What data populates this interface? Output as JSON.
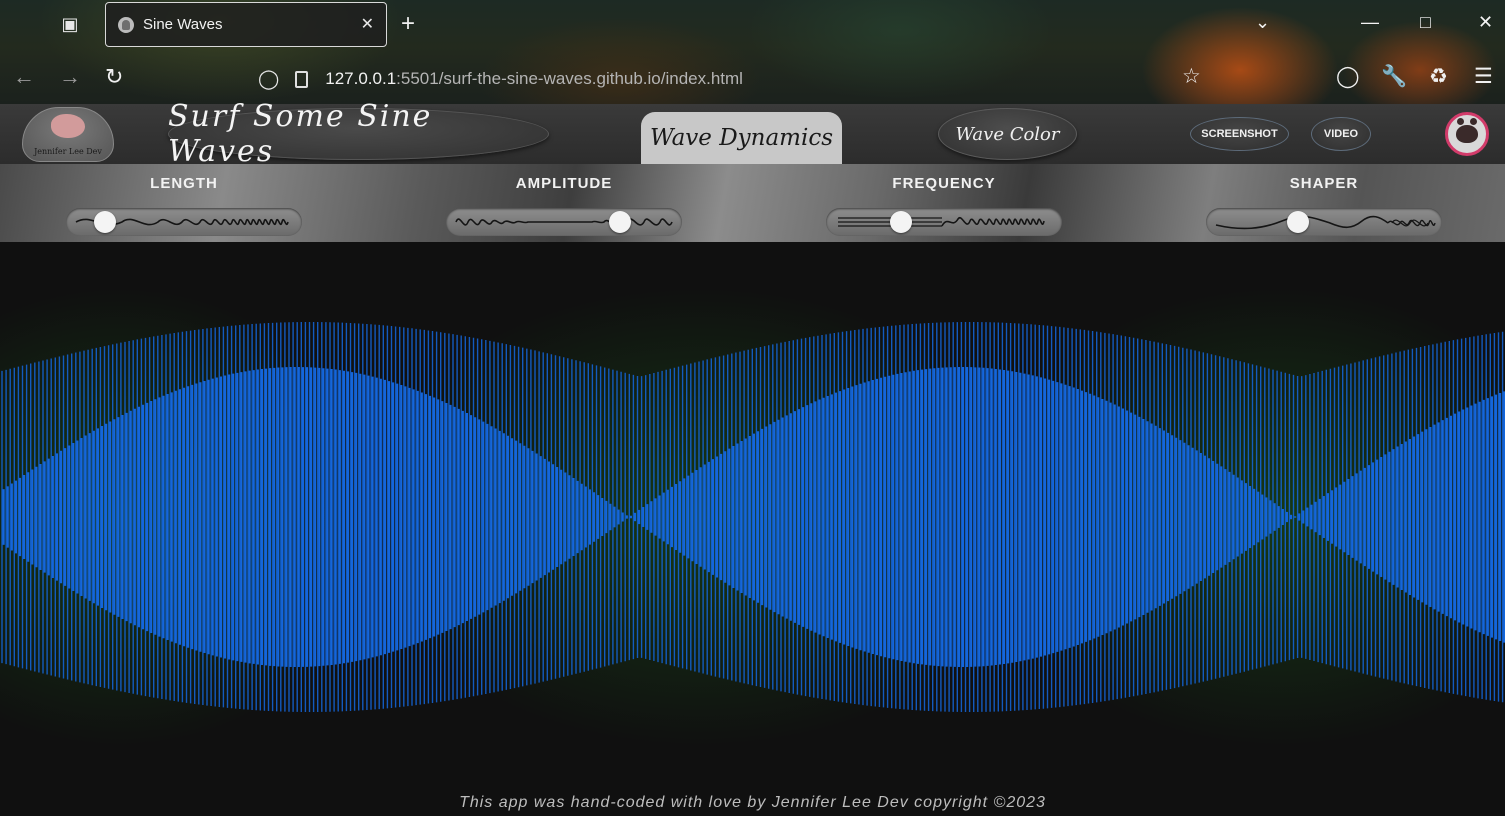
{
  "browser": {
    "tab_title": "Sine Waves",
    "url_host": "127.0.0.1",
    "url_rest": ":5501/surf-the-sine-waves.github.io/index.html"
  },
  "header": {
    "logo_text": "Jennifer Lee Dev",
    "title": "Surf Some Sine Waves",
    "tabs": [
      {
        "label": "Wave Dynamics",
        "active": true
      },
      {
        "label": "Wave Color",
        "active": false
      }
    ],
    "screenshot_label": "SCREENSHOT",
    "video_label": "VIDEO"
  },
  "controls": [
    {
      "label": "LENGTH",
      "value": 0.13
    },
    {
      "label": "AMPLITUDE",
      "value": 0.76
    },
    {
      "label": "FREQUENCY",
      "value": 0.3
    },
    {
      "label": "SHAPER",
      "value": 0.38
    }
  ],
  "waveform": {
    "color": "#1466dc",
    "glow_color": "#1a5a1a",
    "background": "#101010"
  },
  "footer": {
    "text": "This app was hand-coded with love by Jennifer Lee Dev copyright ©2023"
  }
}
